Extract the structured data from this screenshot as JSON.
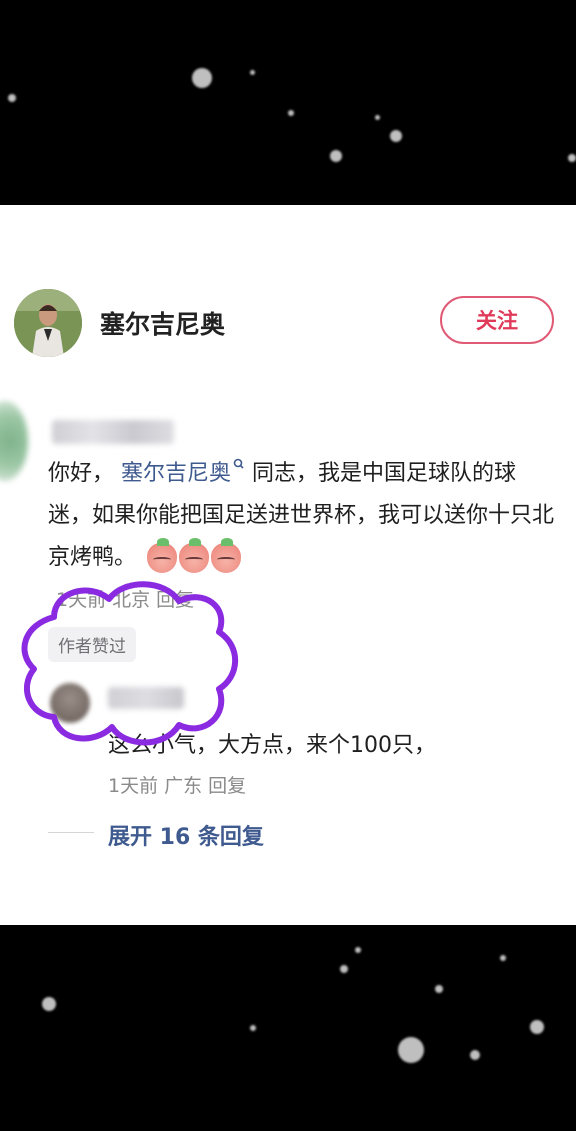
{
  "author": {
    "name": "塞尔吉尼奥",
    "follow_label": "关注"
  },
  "comment": {
    "text_prefix": "你好，",
    "mention": "塞尔吉尼奥",
    "mention_icon": "search-icon",
    "text_body": "同志，我是中国足球队的球迷，如果你能把国足送进世界杯，我可以送你十只北京烤鸭。",
    "emojis": [
      "peach-face-emoji",
      "peach-face-emoji",
      "peach-face-emoji"
    ],
    "meta": "1天前 北京 回复",
    "author_liked_badge": "作者赞过"
  },
  "reply": {
    "text": "这么小气，大方点，来个100只，",
    "meta": "1天前 广东 回复"
  },
  "expand": {
    "label": "展开 16 条回复"
  },
  "colors": {
    "follow_accent": "#e03a5a",
    "mention": "#3f5a8f",
    "scribble": "#8a2be2"
  }
}
